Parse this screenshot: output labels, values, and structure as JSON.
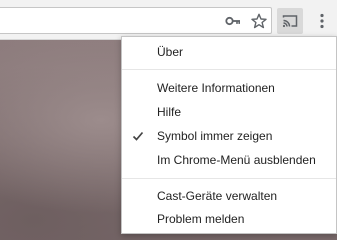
{
  "toolbar": {
    "icons": {
      "key": "key-icon",
      "star": "star-icon",
      "cast": "cast-icon",
      "menu": "more-vert-icon"
    },
    "cast_button_active_color": "#d9d9d9"
  },
  "context_menu": {
    "items": [
      {
        "label": "Über",
        "checked": false
      },
      {
        "label": "Weitere Informationen",
        "checked": false
      },
      {
        "label": "Hilfe",
        "checked": false
      },
      {
        "label": "Symbol immer zeigen",
        "checked": true
      },
      {
        "label": "Im Chrome-Menü ausblenden",
        "checked": false
      },
      {
        "label": "Cast-Geräte verwalten",
        "checked": false
      },
      {
        "label": "Problem melden",
        "checked": false
      }
    ]
  }
}
